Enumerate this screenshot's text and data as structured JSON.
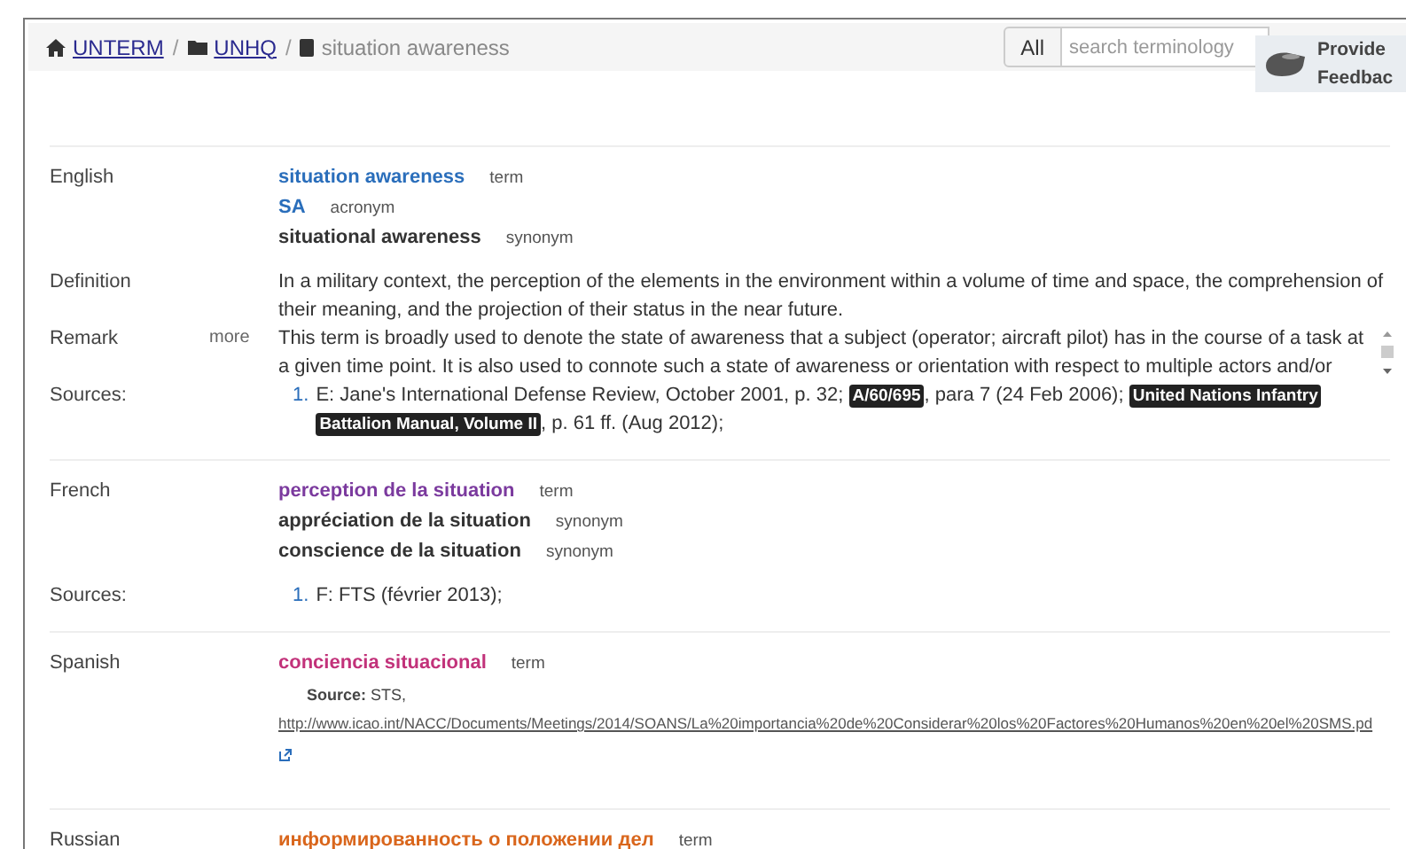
{
  "breadcrumb_separator": "/",
  "breadcrumb": [
    {
      "label": "UNTERM",
      "kind": "home"
    },
    {
      "label": "UNHQ",
      "kind": "folder"
    },
    {
      "label": "situation awareness",
      "kind": "current"
    }
  ],
  "search": {
    "scope": "All",
    "placeholder": "search terminology"
  },
  "feedback": {
    "label": "Provide Feedbac"
  },
  "languages": [
    {
      "name": "English",
      "color": "#2a6ebb",
      "terms": [
        {
          "text": "situation awareness",
          "type": "term",
          "kind": "main"
        },
        {
          "text": "SA",
          "type": "acronym",
          "kind": "main"
        },
        {
          "text": "situational awareness",
          "type": "synonym",
          "kind": "synonym"
        }
      ],
      "fields": [
        {
          "kind": "text",
          "label": "Definition",
          "text": "In a military context, the perception of the elements in the environment within a volume of time and space, the comprehension of their meaning, and the projection of their status in the near future."
        },
        {
          "kind": "scroll",
          "label": "Remark",
          "more": "more",
          "text": "This term is broadly used to denote the state of awareness that a subject (operator; aircraft pilot) has in the course of a task at a given time point. It is also used to connote such a state of awareness or orientation with respect to multiple actors and/or"
        },
        {
          "kind": "sources",
          "label": "Sources:",
          "items": [
            {
              "number": "1.",
              "parts": [
                {
                  "kind": "plain",
                  "text": "E: Jane's International Defense Review, October 2001, p. 32; "
                },
                {
                  "kind": "badge",
                  "text": "A/60/695"
                },
                {
                  "kind": "plain",
                  "text": ", para 7 (24 Feb 2006); "
                },
                {
                  "kind": "badge",
                  "text": "United Nations Infantry Battalion Manual, Volume II"
                },
                {
                  "kind": "plain",
                  "text": ", p. 61 ff. (Aug 2012);"
                }
              ]
            }
          ]
        }
      ]
    },
    {
      "name": "French",
      "color": "#7b3a9e",
      "terms": [
        {
          "text": "perception de la situation",
          "type": "term",
          "kind": "main"
        },
        {
          "text": "appréciation de la situation",
          "type": "synonym",
          "kind": "synonym"
        },
        {
          "text": "conscience de la situation",
          "type": "synonym",
          "kind": "synonym"
        }
      ],
      "fields": [
        {
          "kind": "sources",
          "label": "Sources:",
          "items": [
            {
              "number": "1.",
              "parts": [
                {
                  "kind": "plain",
                  "text": "F: FTS (février 2013);"
                }
              ]
            }
          ]
        }
      ]
    },
    {
      "name": "Spanish",
      "color": "#c2327a",
      "terms": [
        {
          "text": "conciencia situacional",
          "type": "term",
          "kind": "main"
        }
      ],
      "fields": [
        {
          "kind": "note",
          "text": "**Source:** STS,",
          "link": "http://www.icao.int/NACC/Documents/Meetings/2014/SOANS/La%20importancia%20de%20Considerar%20los%20Factores%20Humanos%20en%20el%20SMS.pd"
        }
      ]
    },
    {
      "name": "Russian",
      "color": "#d9661c",
      "terms": [
        {
          "text": "информированность о положении дел",
          "type": "term",
          "kind": "main"
        }
      ]
    }
  ]
}
